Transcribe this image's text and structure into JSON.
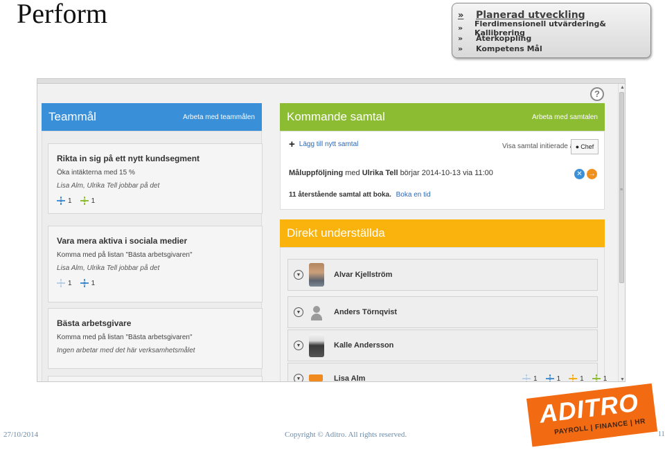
{
  "slide": {
    "title": "Perform",
    "agenda": {
      "bullet": "»",
      "items": [
        "Planerad utveckling",
        "Flerdimensionell utvärdering& Kallibrering",
        "Återkoppling",
        "Kompetens Mål"
      ]
    }
  },
  "app": {
    "help_label": "?",
    "team_panel": {
      "title": "Teammål",
      "link": "Arbeta med teammålen",
      "color": "#3a8fd9",
      "goals": [
        {
          "title": "Rikta in sig på ett nytt kundsegment",
          "desc": "Öka intäkterna med 15 %",
          "owner": "Lisa Alm, Ulrika Tell jobbar på det",
          "stat_a": "1",
          "stat_b": "1"
        },
        {
          "title": "Vara mera aktiva i sociala medier",
          "desc": "Komma med på listan \"Bästa arbetsgivaren\"",
          "owner": "Lisa Alm, Ulrika Tell jobbar på det",
          "stat_a": "1",
          "stat_b": "1"
        },
        {
          "title": "Bästa arbetsgivare",
          "desc": "Komma med på listan \"Bästa arbetsgivaren\"",
          "owner": "Ingen arbetar med det här verksamhetsmålet"
        }
      ]
    },
    "meetings_panel": {
      "title": "Kommande samtal",
      "link": "Arbeta med samtalen",
      "color": "#8cbc31",
      "add_label": "Lägg till nytt samtal",
      "filter_label": "Visa samtal initierade av:",
      "chef_label": "Chef",
      "meeting": {
        "type": "Måluppföljning",
        "with_word": "med",
        "person": "Ulrika Tell",
        "starts_text": "börjar 2014-10-13 via 11:00"
      },
      "remaining": {
        "text": "11 återstående samtal att boka.",
        "book_link": "Boka en tid"
      }
    },
    "direct_panel": {
      "title": "Direkt underställda",
      "color": "#f9b30c",
      "people": [
        {
          "name": "Alvar Kjellström",
          "avatar": "photo"
        },
        {
          "name": "Anders Törnqvist",
          "avatar": "generic"
        },
        {
          "name": "Kalle Andersson",
          "avatar": "photo"
        },
        {
          "name": "Lisa Alm",
          "avatar": "logo",
          "stats": [
            "1",
            "1",
            "1",
            "1"
          ]
        }
      ]
    }
  },
  "footer": {
    "date": "27/10/2014",
    "copyright": "Copyright © Aditro. All rights reserved.",
    "page": "11",
    "logo_word": "ADITRO",
    "logo_sub": "PAYROLL | FINANCE | HR",
    "logo_color": "#f26b12"
  }
}
